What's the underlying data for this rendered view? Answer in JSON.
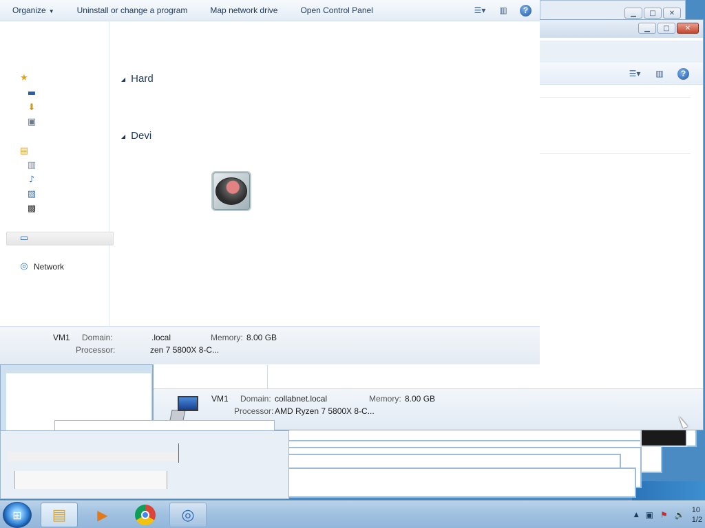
{
  "front_explorer": {
    "commands": [
      "Organize",
      "Uninstall or change a program",
      "Map network drive",
      "Open Control Panel"
    ],
    "nav": {
      "network_label": "Network"
    },
    "groups": [
      "Hard",
      "Devi"
    ],
    "details": {
      "computer_name": "VM1",
      "domain_label": "Domain:",
      "domain_value": "collabnet.local",
      "domain_value_partial": ".local",
      "memory_label": "Memory:",
      "memory_value": "8.00 GB",
      "processor_label": "Processor:",
      "processor_value": "AMD Ryzen 7 5800X 8-C...",
      "processor_value_partial": "zen 7 5800X 8-C..."
    }
  },
  "back_explorer": {
    "details": {
      "computer_name": "VM1",
      "domain_label": "Domain:",
      "domain_value": "collabnet.local",
      "memory_label": "Memory:",
      "memory_value": "8.00 GB",
      "processor_label": "Processor:",
      "processor_value": "AMD Ryzen 7 5800X 8-C..."
    }
  },
  "taskbar": {
    "buttons": [
      "windows-explorer",
      "media-player",
      "chrome",
      "network-globe"
    ],
    "clock_time": "10",
    "clock_date": "1/2"
  },
  "colors": {
    "accent": "#1e395b",
    "taskbar": "#9fc0e0",
    "desktop": "#4a8bc4"
  }
}
